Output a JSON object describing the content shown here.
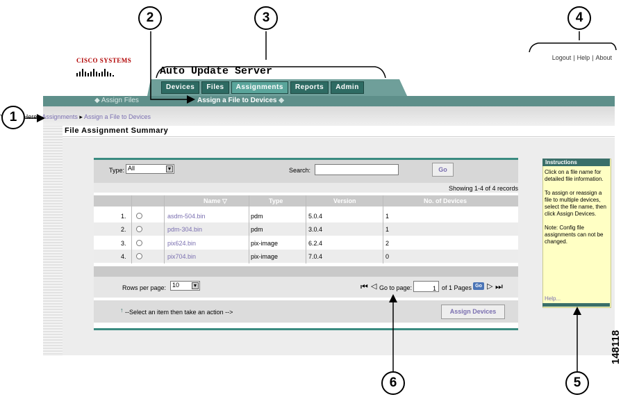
{
  "app": {
    "brand": "Cisco Systems",
    "title": "Auto Update Server",
    "top_links": [
      "Logout",
      "Help",
      "About"
    ]
  },
  "tabs": [
    {
      "label": "Devices",
      "active": false
    },
    {
      "label": "Files",
      "active": false
    },
    {
      "label": "Assignments",
      "active": true
    },
    {
      "label": "Reports",
      "active": false
    },
    {
      "label": "Admin",
      "active": false
    }
  ],
  "subnav": {
    "assign_files": "Assign Files",
    "current": "Assign a File to Devices"
  },
  "breadcrumb": {
    "prefix": "You Are Here",
    "items": [
      "Assignments",
      "Assign a File to Devices"
    ]
  },
  "page_title": "File Assignment Summary",
  "filter": {
    "type_label": "Type:",
    "type_value": "All",
    "search_label": "Search:",
    "search_value": "",
    "go_label": "Go"
  },
  "showing": "Showing 1-4 of 4 records",
  "table": {
    "columns": [
      "Name",
      "Type",
      "Version",
      "No. of Devices"
    ],
    "sort_indicator": "▽",
    "rows": [
      {
        "index": "1.",
        "name": "asdm-504.bin",
        "type": "pdm",
        "version": "5.0.4",
        "devices": "1"
      },
      {
        "index": "2.",
        "name": "pdm-304.bin",
        "type": "pdm",
        "version": "3.0.4",
        "devices": "1"
      },
      {
        "index": "3.",
        "name": "pix624.bin",
        "type": "pix-image",
        "version": "6.2.4",
        "devices": "2"
      },
      {
        "index": "4.",
        "name": "pix704.bin",
        "type": "pix-image",
        "version": "7.0.4",
        "devices": "0"
      }
    ]
  },
  "pager": {
    "rows_per_page_label": "Rows per page:",
    "rows_per_page_value": "10",
    "goto_label": "Go to page:",
    "page_value": "1",
    "of_pages": "of 1 Pages",
    "go_label": "Go"
  },
  "actions": {
    "hint": "--Select an item then take an action -->",
    "assign_devices": "Assign Devices"
  },
  "instructions": {
    "title": "Instructions",
    "paragraphs": [
      "Click on a file name for detailed file information.",
      "To assign or reassign a file to multiple devices, select the file name, then click Assign Devices.",
      "Note: Config file assignments can not be changed."
    ],
    "help": "Help..."
  },
  "callouts": [
    "1",
    "2",
    "3",
    "4",
    "5",
    "6"
  ],
  "figure_id": "148118",
  "colors": {
    "tab_bg": "#2e6b63",
    "tab_active": "#5aa59b",
    "link": "#7a6fb0",
    "accent": "#3a8b80",
    "instructions_bg": "#ffffc4"
  }
}
